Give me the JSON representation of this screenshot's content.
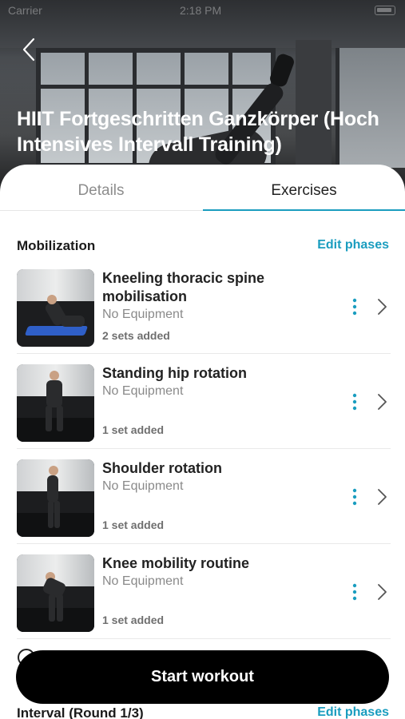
{
  "status_bar": {
    "carrier": "Carrier",
    "time": "2:18 PM"
  },
  "header": {
    "back_icon": "chevron-left-icon",
    "title": "HIIT Fortgeschritten Ganzkörper (Hoch Intensives Intervall Training)"
  },
  "tabs": [
    {
      "label": "Details",
      "active": false
    },
    {
      "label": "Exercises",
      "active": true
    }
  ],
  "accent_color": "#1a9dbf",
  "phases": [
    {
      "title": "Mobilization",
      "edit_label": "Edit phases",
      "exercises": [
        {
          "name": "Kneeling thoracic spine mobilisation",
          "equipment": "No Equipment",
          "sets": "2 sets added"
        },
        {
          "name": "Standing hip rotation",
          "equipment": "No Equipment",
          "sets": "1 set added"
        },
        {
          "name": "Shoulder rotation",
          "equipment": "No Equipment",
          "sets": "1 set added"
        },
        {
          "name": "Knee mobility routine",
          "equipment": "No Equipment",
          "sets": "1 set added"
        }
      ]
    },
    {
      "title": "Interval (Round 1/3)",
      "edit_label": "Edit phases"
    }
  ],
  "cta": {
    "label": "Start workout"
  }
}
